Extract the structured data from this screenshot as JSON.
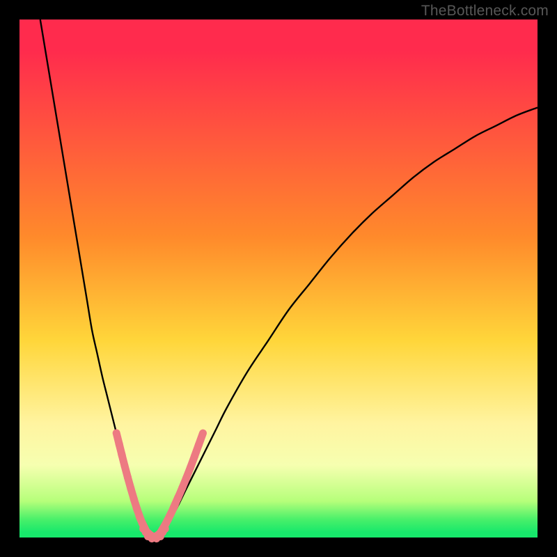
{
  "watermark": {
    "text": "TheBottleneck.com"
  },
  "colors": {
    "top": "#ff2b4d",
    "orange": "#ff8a2b",
    "yellow": "#ffd63a",
    "pale": "#fff4a0",
    "pale2": "#f6ffb0",
    "lime": "#b6ff7a",
    "green": "#49f06a",
    "green2": "#17e86b",
    "curve": "#000000",
    "marker": "#ed7a82"
  },
  "chart_data": {
    "type": "line",
    "title": "",
    "xlabel": "",
    "ylabel": "",
    "xlim": [
      0,
      100
    ],
    "ylim": [
      0,
      100
    ],
    "series": [
      {
        "name": "bottleneck-curve",
        "comment": "V-shaped funnel; y = distance from optimal (0 = green floor, 100 = top red). x is normalized component-balance axis.",
        "x": [
          4,
          5,
          6,
          7,
          8,
          9,
          10,
          11,
          12,
          13,
          14,
          15,
          16,
          17,
          18,
          19,
          20,
          21,
          22,
          23,
          24,
          25,
          26,
          27,
          28,
          30,
          32,
          34,
          36,
          38,
          40,
          44,
          48,
          52,
          56,
          60,
          64,
          68,
          72,
          76,
          80,
          84,
          88,
          92,
          96,
          100
        ],
        "y": [
          100,
          94,
          88,
          82,
          76,
          70,
          64,
          58,
          52,
          46,
          40,
          35.5,
          31,
          27,
          23,
          19,
          15,
          11,
          7,
          4,
          2,
          0.5,
          0,
          0.5,
          2,
          5,
          9,
          13,
          17,
          21,
          25,
          32,
          38,
          44,
          49,
          54,
          58.5,
          62.5,
          66,
          69.5,
          72.5,
          75,
          77.5,
          79.5,
          81.5,
          83
        ]
      }
    ],
    "markers": {
      "comment": "pink bead clusters near the trough on both arms",
      "left_arm": [
        {
          "x": 19,
          "y": 19
        },
        {
          "x": 19.5,
          "y": 17
        },
        {
          "x": 20,
          "y": 15
        },
        {
          "x": 20.6,
          "y": 12.7
        },
        {
          "x": 21.2,
          "y": 10.5
        },
        {
          "x": 21.8,
          "y": 8.4
        },
        {
          "x": 22.4,
          "y": 6.4
        },
        {
          "x": 23,
          "y": 4.6
        },
        {
          "x": 23.6,
          "y": 3
        },
        {
          "x": 24.2,
          "y": 1.8
        }
      ],
      "right_arm": [
        {
          "x": 27.6,
          "y": 1.6
        },
        {
          "x": 28.2,
          "y": 2.6
        },
        {
          "x": 28.8,
          "y": 3.8
        },
        {
          "x": 29.5,
          "y": 5.2
        },
        {
          "x": 30.2,
          "y": 6.8
        },
        {
          "x": 31,
          "y": 8.6
        },
        {
          "x": 31.8,
          "y": 10.5
        },
        {
          "x": 32.6,
          "y": 12.5
        },
        {
          "x": 33.4,
          "y": 14.6
        },
        {
          "x": 34.2,
          "y": 16.8
        },
        {
          "x": 35,
          "y": 19
        }
      ],
      "trough": [
        {
          "x": 24.8,
          "y": 0.9
        },
        {
          "x": 25.4,
          "y": 0.4
        },
        {
          "x": 26,
          "y": 0.2
        },
        {
          "x": 26.6,
          "y": 0.4
        },
        {
          "x": 27.2,
          "y": 0.9
        }
      ]
    }
  }
}
